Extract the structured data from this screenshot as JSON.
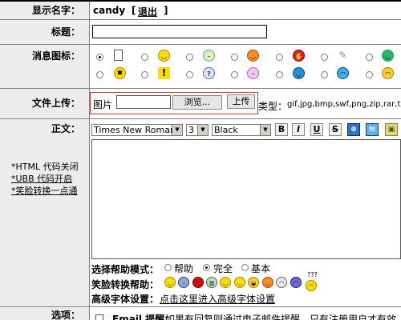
{
  "display_name": {
    "label": "显示名字：",
    "value": "candy",
    "logout_open": "[",
    "logout": "退出",
    "logout_close": "]"
  },
  "title_row": {
    "label": "标题：",
    "value": ""
  },
  "icon_row": {
    "label": "消息图标：",
    "row1": [
      "doc-icon",
      "smile-icon",
      "neutral-face-icon",
      "orange-face-icon",
      "red-hand-icon",
      "pen-icon",
      "green-face-icon"
    ],
    "row2": [
      "lightbulb-icon",
      "exclamation-icon",
      "question-bubble-icon",
      "pink-face-icon",
      "blue-face-icon",
      "sad-blue-face-icon",
      "sad-yellow-face-icon"
    ],
    "selected": 0
  },
  "upload_row": {
    "label": "文件上传：",
    "image_label": "图片",
    "browse": "浏览...",
    "upload": "上传",
    "types_label": "类型：",
    "types": "gif,jpg,bmp,swf,png,zip,rar,txt,doc"
  },
  "body_row": {
    "label": "正文：",
    "html_code": "*HTML 代码关闭",
    "ubb_code": "*UBB  代码开启",
    "smiley_convert": "*笑脸转换一点通",
    "font": "Times New Roman",
    "size": "3",
    "color": "Black",
    "bold": "B",
    "italic": "I",
    "underline": "U",
    "strike": "S"
  },
  "help_mode": {
    "label": "选择帮助模式：",
    "options": [
      "帮助",
      "完全",
      "基本"
    ],
    "selected": 1
  },
  "smiley_help": {
    "label": "笑脸转换帮助："
  },
  "font_settings": {
    "label": "高级字体设置：",
    "link": "点击这里进入高级字体设置"
  },
  "options_row": {
    "label": "选项：",
    "email_label": "Email 提醒:",
    "email_text": "如果有回复则通过电子邮件提醒，只有注册用户才有效"
  }
}
